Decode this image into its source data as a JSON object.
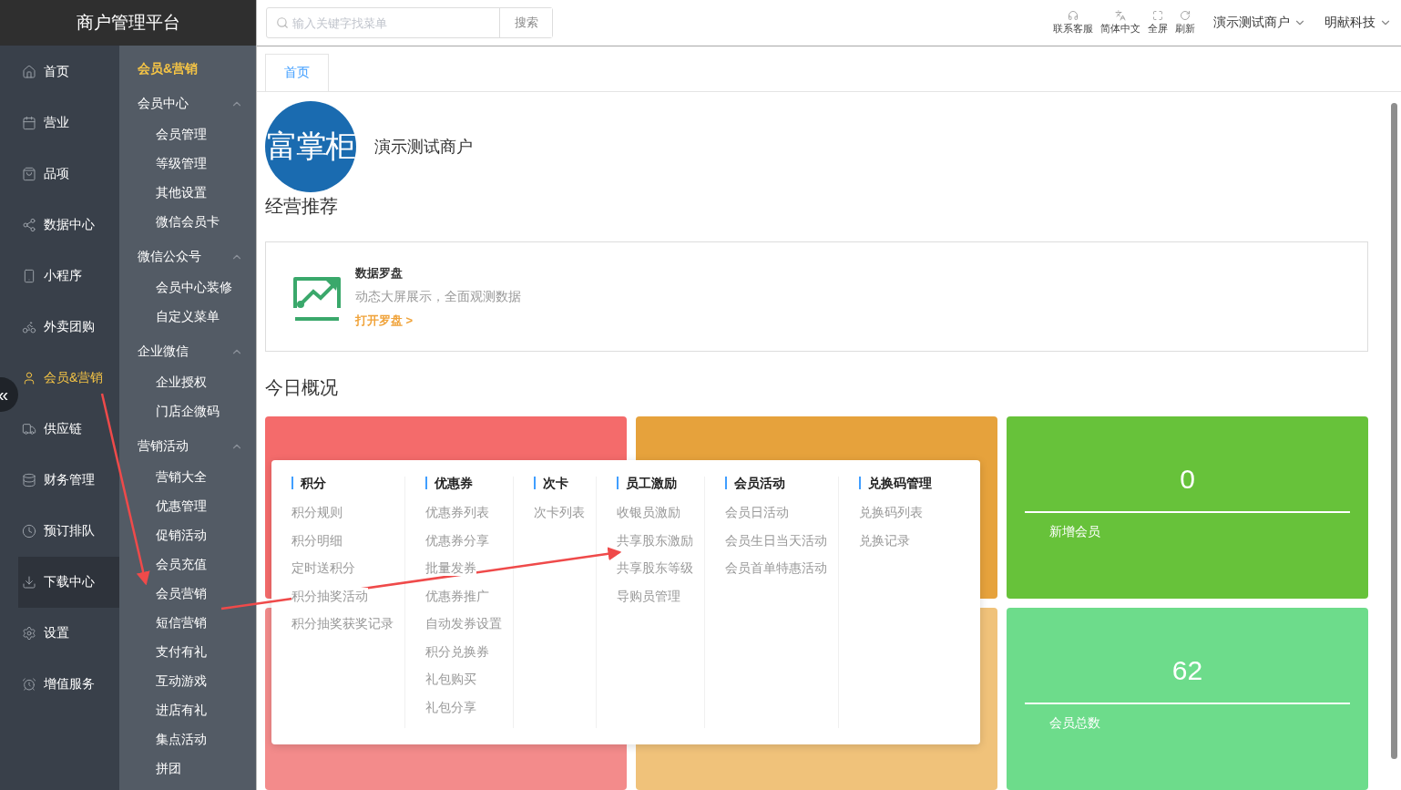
{
  "brand": {
    "title": "商户管理平台"
  },
  "nav": [
    {
      "label": "首页",
      "selected": false,
      "hovered": false
    },
    {
      "label": "营业",
      "selected": false,
      "hovered": false
    },
    {
      "label": "品项",
      "selected": false,
      "hovered": false
    },
    {
      "label": "数据中心",
      "selected": false,
      "hovered": false
    },
    {
      "label": "小程序",
      "selected": false,
      "hovered": false
    },
    {
      "label": "外卖团购",
      "selected": false,
      "hovered": false
    },
    {
      "label": "会员&营销",
      "selected": true,
      "hovered": false
    },
    {
      "label": "供应链",
      "selected": false,
      "hovered": false
    },
    {
      "label": "财务管理",
      "selected": false,
      "hovered": false
    },
    {
      "label": "预订排队",
      "selected": false,
      "hovered": false
    },
    {
      "label": "下载中心",
      "selected": false,
      "hovered": true
    },
    {
      "label": "设置",
      "selected": false,
      "hovered": false
    },
    {
      "label": "增值服务",
      "selected": false,
      "hovered": false
    }
  ],
  "collapse_button": {
    "label": "«"
  },
  "submenu": {
    "title": "会员&营销",
    "groups": [
      {
        "label": "会员中心",
        "expanded": true,
        "items": [
          "会员管理",
          "等级管理",
          "其他设置",
          "微信会员卡"
        ]
      },
      {
        "label": "微信公众号",
        "expanded": true,
        "items": [
          "会员中心装修",
          "自定义菜单"
        ]
      },
      {
        "label": "企业微信",
        "expanded": true,
        "items": [
          "企业授权",
          "门店企微码"
        ]
      },
      {
        "label": "营销活动",
        "expanded": true,
        "items": [
          "营销大全",
          "优惠管理",
          "促销活动",
          "会员充值",
          "会员营销",
          "短信营销",
          "支付有礼",
          "互动游戏",
          "进店有礼",
          "集点活动",
          "拼团"
        ]
      }
    ]
  },
  "topbar": {
    "search": {
      "placeholder": "输入关键字找菜单",
      "button": "搜索"
    },
    "tools": [
      "联系客服",
      "简体中文",
      "全屏",
      "刷新"
    ],
    "menus": [
      "演示测试商户",
      "明献科技"
    ]
  },
  "tabs": [
    {
      "label": "首页",
      "selected": true
    }
  ],
  "merchant": {
    "logo_text": "富掌柜",
    "name": "演示测试商户"
  },
  "recommend": {
    "title": "经营推荐",
    "card": {
      "title": "数据罗盘",
      "description": "动态大屏展示，全面观测数据",
      "link": "打开罗盘 >"
    }
  },
  "overview": {
    "title": "今日概况",
    "cards": [
      {
        "color": "#f46b6b"
      },
      {
        "color": "#e6a23c"
      },
      {
        "color": "#67c23a",
        "value": "0",
        "label": "新增会员"
      },
      {
        "color": "#f38b8b"
      },
      {
        "color": "#f0c27a"
      },
      {
        "color": "#6ddc8b",
        "value": "62",
        "label": "会员总数"
      }
    ]
  },
  "popup_menu": {
    "columns": [
      {
        "title": "积分",
        "items": [
          "积分规则",
          "积分明细",
          "定时送积分",
          "积分抽奖活动",
          "积分抽奖获奖记录"
        ]
      },
      {
        "title": "优惠券",
        "items": [
          "优惠券列表",
          "优惠券分享",
          "批量发券",
          "优惠券推广",
          "自动发券设置",
          "积分兑换券",
          "礼包购买",
          "礼包分享"
        ]
      },
      {
        "title": "次卡",
        "items": [
          "次卡列表"
        ]
      },
      {
        "title": "员工激励",
        "items": [
          "收银员激励",
          "共享股东激励",
          "共享股东等级",
          "导购员管理"
        ]
      },
      {
        "title": "会员活动",
        "items": [
          "会员日活动",
          "会员生日当天活动",
          "会员首单特惠活动"
        ]
      },
      {
        "title": "兑换码管理",
        "items": [
          "兑换码列表",
          "兑换记录"
        ]
      }
    ]
  }
}
